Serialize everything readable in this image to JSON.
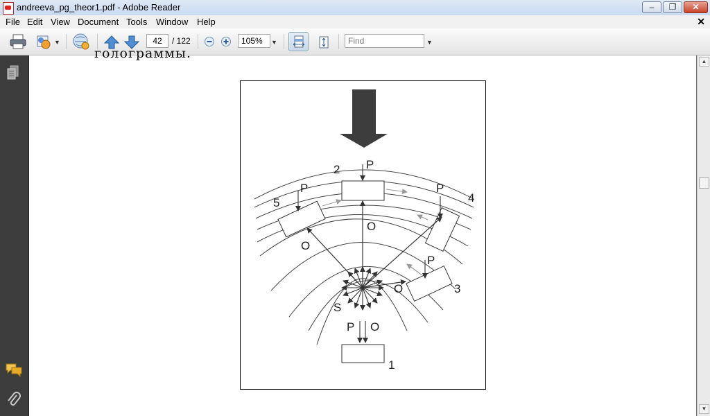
{
  "window": {
    "title": "andreeva_pg_theor1.pdf - Adobe Reader"
  },
  "menubar": {
    "items": [
      "File",
      "Edit",
      "View",
      "Document",
      "Tools",
      "Window",
      "Help"
    ],
    "close_glyph": "✕"
  },
  "toolbar": {
    "page_current": "42",
    "page_total": "/ 122",
    "zoom": "105%",
    "find_placeholder": "Find"
  },
  "document": {
    "cut_text": "голограммы.",
    "figure_labels": {
      "p_top": "P",
      "n2": "2",
      "p_left": "P",
      "n5": "5",
      "p_right": "P",
      "n4": "4",
      "o_center": "O",
      "o_left": "O",
      "p_lower": "P",
      "o_lower": "O",
      "n3": "3",
      "s": "S",
      "p_bottom": "P",
      "o_bottom": "O",
      "n1": "1"
    }
  },
  "icons": [
    "pdf-icon",
    "print-icon",
    "share-icon",
    "collaborate-icon",
    "prev-page-icon",
    "next-page-icon",
    "zoom-out-icon",
    "zoom-in-icon",
    "fit-width-icon",
    "fit-page-icon",
    "pages-panel-icon",
    "comments-icon",
    "attachments-icon"
  ]
}
